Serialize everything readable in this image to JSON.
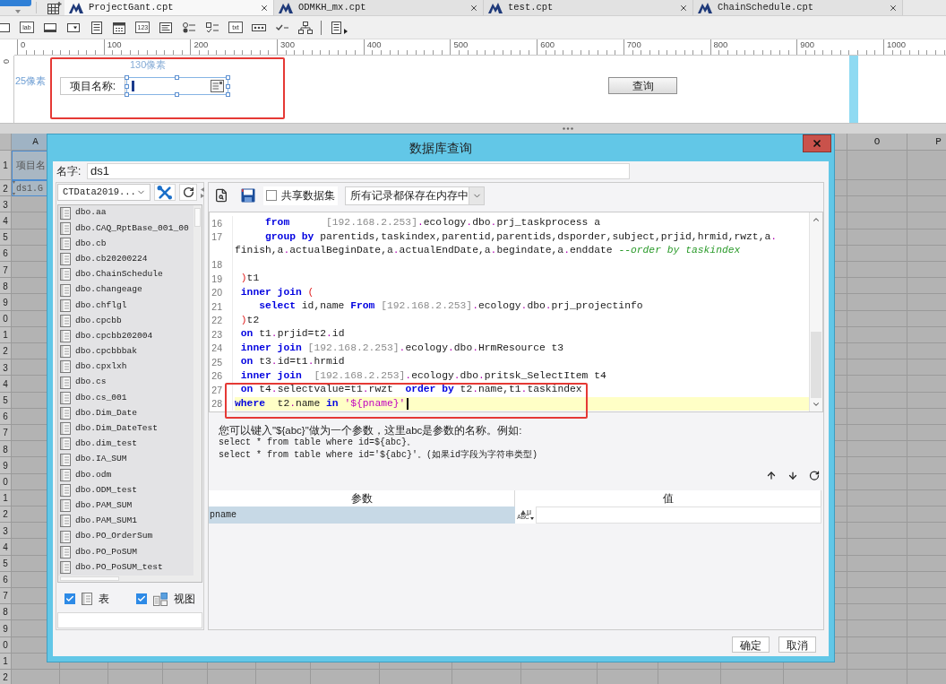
{
  "tabs": [
    {
      "label": "ProjectGant.cpt",
      "selected": true
    },
    {
      "label": "ODMKH_mx.cpt",
      "selected": false
    },
    {
      "label": "test.cpt",
      "selected": false
    },
    {
      "label": "ChainSchedule.cpt",
      "selected": false
    }
  ],
  "toolbar": [
    {
      "kind": "frame"
    },
    {
      "kind": "label",
      "label": "lab"
    },
    {
      "kind": "button"
    },
    {
      "kind": "combo"
    },
    {
      "kind": "list"
    },
    {
      "kind": "date"
    },
    {
      "kind": "number",
      "label": "123"
    },
    {
      "kind": "textarea"
    },
    {
      "kind": "radio_group"
    },
    {
      "kind": "checkbox_group"
    },
    {
      "kind": "text",
      "label": "txt"
    },
    {
      "kind": "password"
    },
    {
      "kind": "checkbox"
    },
    {
      "kind": "tree"
    },
    {
      "kind": "more"
    }
  ],
  "ruler": {
    "labels": [
      "0",
      "100",
      "200",
      "300",
      "400",
      "500",
      "600",
      "700",
      "800",
      "900",
      "1000"
    ]
  },
  "vertical_ruler": {
    "label": "0"
  },
  "canvas": {
    "width_hint": "130像素",
    "height_hint": "25像素",
    "field_label": "项目名称:",
    "button": "查询"
  },
  "sheet": {
    "columns": [
      {
        "label": "A",
        "selected": true
      },
      {
        "label": "O",
        "selected": false
      },
      {
        "label": "P",
        "selected": false
      }
    ],
    "row_numbers": [
      "1",
      "2",
      "3",
      "4",
      "5",
      "6",
      "7",
      "8",
      "9",
      "0",
      "1",
      "2",
      "3",
      "4",
      "5",
      "6",
      "7",
      "8",
      "9",
      "0",
      "1",
      "2",
      "3",
      "4",
      "5",
      "6",
      "7",
      "8",
      "9",
      "0",
      "1",
      "2"
    ],
    "cells": [
      {
        "kind": "text",
        "text": "项目名",
        "selected": true
      },
      {
        "kind": "data_column",
        "text": "ds1.G",
        "selected": true
      }
    ]
  },
  "dialog": {
    "title": "数据库查询",
    "name": {
      "label": "名字:",
      "value": "ds1"
    },
    "connection": "CTData2019...",
    "tables": [
      "dbo.aa",
      "dbo.CAQ_RptBase_001_00",
      "dbo.cb",
      "dbo.cb20200224",
      "dbo.ChainSchedule",
      "dbo.changeage",
      "dbo.chflgl",
      "dbo.cpcbb",
      "dbo.cpcbb202004",
      "dbo.cpcbbbak",
      "dbo.cpxlxh",
      "dbo.cs",
      "dbo.cs_001",
      "dbo.Dim_Date",
      "dbo.Dim_DateTest",
      "dbo.dim_test",
      "dbo.IA_SUM",
      "dbo.odm",
      "dbo.ODM_test",
      "dbo.PAM_SUM",
      "dbo.PAM_SUM1",
      "dbo.PO_OrderSum",
      "dbo.PO_PoSUM",
      "dbo.PO_PoSUM_test"
    ],
    "filters": [
      {
        "kind": "table",
        "label": "表",
        "checked": true
      },
      {
        "kind": "view",
        "label": "视图",
        "checked": true
      }
    ],
    "share_dataset": {
      "label": "共享数据集",
      "checked": false
    },
    "storage_mode": "所有记录都保存在内存中",
    "editor": {
      "lines": [
        {
          "number": "16",
          "current": false,
          "tokens": [
            {
              "kind": "keyword",
              "text": "     from"
            },
            {
              "kind": "server",
              "text": "      [192.168.2.253]"
            },
            {
              "kind": "dot",
              "text": "."
            },
            {
              "kind": "plain",
              "text": "ecology"
            },
            {
              "kind": "dot",
              "text": "."
            },
            {
              "kind": "plain",
              "text": "dbo"
            },
            {
              "kind": "dot",
              "text": "."
            },
            {
              "kind": "plain",
              "text": "prj_taskprocess a"
            }
          ]
        },
        {
          "number": "17",
          "current": false,
          "tokens": [
            {
              "kind": "keyword",
              "text": "     group by"
            },
            {
              "kind": "plain",
              "text": " parentids,taskindex,parentid,parentids,dsporder,subject,prjid,hrmid,rwzt,a"
            },
            {
              "kind": "dot",
              "text": "."
            }
          ],
          "wrap_tokens": [
            {
              "kind": "plain",
              "text": "finish,a"
            },
            {
              "kind": "dot",
              "text": "."
            },
            {
              "kind": "plain",
              "text": "actualBeginDate,a"
            },
            {
              "kind": "dot",
              "text": "."
            },
            {
              "kind": "plain",
              "text": "actualEndDate,a"
            },
            {
              "kind": "dot",
              "text": "."
            },
            {
              "kind": "plain",
              "text": "begindate,a"
            },
            {
              "kind": "dot",
              "text": "."
            },
            {
              "kind": "plain",
              "text": "enddate"
            },
            {
              "kind": "comment",
              "text": " --order by taskindex"
            }
          ]
        },
        {
          "number": "18",
          "current": false
        },
        {
          "number": "19",
          "current": false,
          "tokens": [
            {
              "kind": "paren",
              "text": " )"
            },
            {
              "kind": "plain",
              "text": "t1"
            }
          ]
        },
        {
          "number": "20",
          "current": false,
          "tokens": [
            {
              "kind": "keyword",
              "text": " inner join"
            },
            {
              "kind": "paren",
              "text": " ("
            }
          ]
        },
        {
          "number": "21",
          "current": false,
          "tokens": [
            {
              "kind": "keyword",
              "text": "    select"
            },
            {
              "kind": "plain",
              "text": " id,name "
            },
            {
              "kind": "keyword",
              "text": "From"
            },
            {
              "kind": "server",
              "text": " [192.168.2.253]"
            },
            {
              "kind": "dot",
              "text": "."
            },
            {
              "kind": "plain",
              "text": "ecology"
            },
            {
              "kind": "dot",
              "text": "."
            },
            {
              "kind": "plain",
              "text": "dbo"
            },
            {
              "kind": "dot",
              "text": "."
            },
            {
              "kind": "plain",
              "text": "prj_projectinfo"
            }
          ]
        },
        {
          "number": "22",
          "current": false,
          "tokens": [
            {
              "kind": "paren",
              "text": " )"
            },
            {
              "kind": "plain",
              "text": "t2"
            }
          ]
        },
        {
          "number": "23",
          "current": false,
          "tokens": [
            {
              "kind": "keyword",
              "text": " on"
            },
            {
              "kind": "plain",
              "text": " t1"
            },
            {
              "kind": "dot",
              "text": "."
            },
            {
              "kind": "plain",
              "text": "prjid=t2"
            },
            {
              "kind": "dot",
              "text": "."
            },
            {
              "kind": "plain",
              "text": "id"
            }
          ]
        },
        {
          "number": "24",
          "current": false,
          "tokens": [
            {
              "kind": "keyword",
              "text": " inner join"
            },
            {
              "kind": "server",
              "text": " [192.168.2.253]"
            },
            {
              "kind": "dot",
              "text": "."
            },
            {
              "kind": "plain",
              "text": "ecology"
            },
            {
              "kind": "dot",
              "text": "."
            },
            {
              "kind": "plain",
              "text": "dbo"
            },
            {
              "kind": "dot",
              "text": "."
            },
            {
              "kind": "plain",
              "text": "HrmResource t3"
            }
          ]
        },
        {
          "number": "25",
          "current": false,
          "tokens": [
            {
              "kind": "keyword",
              "text": " on"
            },
            {
              "kind": "plain",
              "text": " t3"
            },
            {
              "kind": "dot",
              "text": "."
            },
            {
              "kind": "plain",
              "text": "id=t1"
            },
            {
              "kind": "dot",
              "text": "."
            },
            {
              "kind": "plain",
              "text": "hrmid"
            }
          ]
        },
        {
          "number": "26",
          "current": false,
          "tokens": [
            {
              "kind": "keyword",
              "text": " inner join"
            },
            {
              "kind": "server",
              "text": "  [192.168.2.253]"
            },
            {
              "kind": "dot",
              "text": "."
            },
            {
              "kind": "plain",
              "text": "ecology"
            },
            {
              "kind": "dot",
              "text": "."
            },
            {
              "kind": "plain",
              "text": "dbo"
            },
            {
              "kind": "dot",
              "text": "."
            },
            {
              "kind": "plain",
              "text": "pritsk_SelectItem t4"
            }
          ]
        },
        {
          "number": "27",
          "current": false,
          "tokens": [
            {
              "kind": "keyword",
              "text": " on"
            },
            {
              "kind": "plain",
              "text": " t4"
            },
            {
              "kind": "dot",
              "text": "."
            },
            {
              "kind": "plain",
              "text": "selectvalue=t1"
            },
            {
              "kind": "dot",
              "text": "."
            },
            {
              "kind": "plain",
              "text": "rwzt  "
            },
            {
              "kind": "keyword",
              "text": "order by"
            },
            {
              "kind": "plain",
              "text": " t2"
            },
            {
              "kind": "dot",
              "text": "."
            },
            {
              "kind": "plain",
              "text": "name,t1"
            },
            {
              "kind": "dot",
              "text": "."
            },
            {
              "kind": "plain",
              "text": "taskindex"
            }
          ]
        },
        {
          "number": "28",
          "current": true,
          "tokens": [
            {
              "kind": "keyword",
              "text": "where"
            },
            {
              "kind": "plain",
              "text": "  t2"
            },
            {
              "kind": "dot",
              "text": "."
            },
            {
              "kind": "plain",
              "text": "name "
            },
            {
              "kind": "keyword",
              "text": "in"
            },
            {
              "kind": "string",
              "text": " '${pname}'"
            }
          ]
        }
      ]
    },
    "hint": {
      "text": "您可以键入\"${abc}\"做为一个参数，这里abc是参数的名称。例如:",
      "examples": [
        "select * from table where id=${abc}。",
        "select * from table where id='${abc}'。(如果id字段为字符串类型)"
      ]
    },
    "params": {
      "columns": [
        "参数",
        "值"
      ],
      "rows": [
        {
          "name": "pname",
          "type_label": "ABC",
          "selected": true
        }
      ]
    },
    "buttons": [
      "确定",
      "取消"
    ]
  }
}
